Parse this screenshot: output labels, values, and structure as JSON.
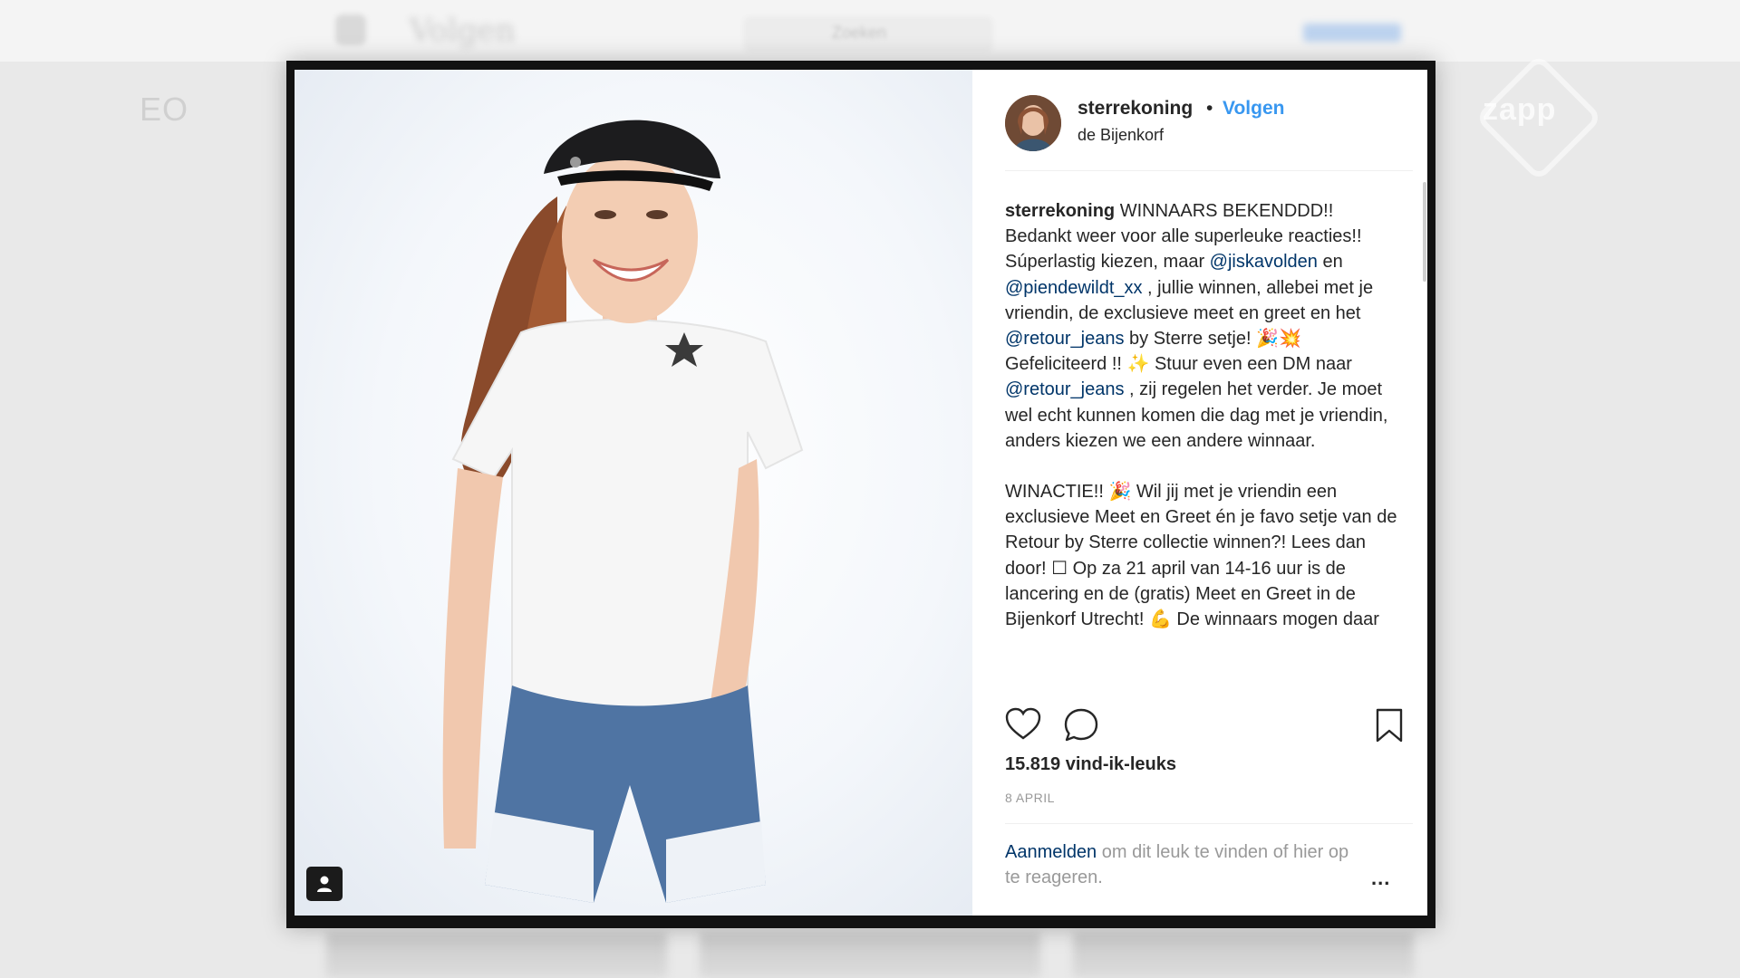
{
  "background": {
    "brand_word": "Volgen",
    "search_placeholder": "Zoeken",
    "broadcaster_logo": "EO",
    "channel_logo": "zapp"
  },
  "post": {
    "username": "sterrekoning",
    "separator": "•",
    "follow_label": "Volgen",
    "location": "de Bijenkorf",
    "caption": {
      "author": "sterrekoning",
      "segments": {
        "s1": " WINNAARS BEKENDDD!! Bedankt weer voor alle superleuke reacties!! Súperlastig kiezen, maar ",
        "m1": "@jiskavolden",
        "s2": " en ",
        "m2": "@piendewildt_xx",
        "s3": " , jullie winnen, allebei met je vriendin, de exclusieve meet en greet en het ",
        "m3": "@retour_jeans",
        "s4": " by Sterre setje! 🎉💥 Gefeliciteerd !! ✨ Stuur even een DM naar ",
        "m4": "@retour_jeans",
        "s5": " , zij regelen het verder. Je moet wel echt kunnen komen die dag met je vriendin, anders kiezen we een andere winnaar.",
        "p2": "WINACTIE!! 🎉 Wil jij met je vriendin een exclusieve Meet en Greet én je favo setje van de Retour by Sterre collectie winnen?! Lees dan door! ☐ Op za 21 april van 14-16 uur is de lancering en de (gratis) Meet en Greet in de Bijenkorf Utrecht! 💪 De winnaars mogen daar"
      }
    },
    "likes": "15.819 vind-ik-leuks",
    "date": "8 APRIL",
    "login_link": "Aanmelden",
    "login_rest": " om dit leuk te vinden of hier op te reageren.",
    "more_label": "..."
  },
  "icons": {
    "like": "heart-icon",
    "comment": "comment-icon",
    "save": "bookmark-icon",
    "tagged_user": "user-tag-icon",
    "more": "more-options-icon"
  },
  "colors": {
    "accent": "#3897f0",
    "mention": "#003569",
    "text": "#262626",
    "muted": "#999999"
  }
}
